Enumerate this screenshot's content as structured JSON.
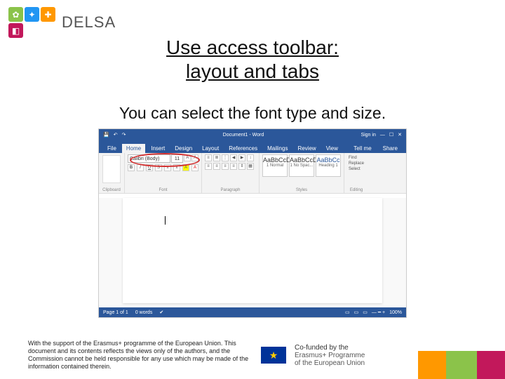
{
  "brand": "DELSA",
  "title_line1": "Use access toolbar:",
  "title_line2": "layout and tabs",
  "description": "You can select the font type and size.",
  "word": {
    "titlebar_center": "Document1 - Word",
    "titlebar_right": "Sign in",
    "tabs": [
      "File",
      "Home",
      "Insert",
      "Design",
      "Layout",
      "References",
      "Mailings",
      "Review",
      "View"
    ],
    "tell_me": "Tell me",
    "share": "Share",
    "groups": {
      "clipboard": "Clipboard",
      "font": "Font",
      "paragraph": "Paragraph",
      "styles": "Styles",
      "editing": "Editing"
    },
    "font_name": "Calibri (Body)",
    "font_size": "11",
    "buttons": {
      "b": "B",
      "i": "I",
      "u": "U",
      "s": "S"
    },
    "styles": [
      {
        "preview": "AaBbCcDd",
        "name": "1 Normal"
      },
      {
        "preview": "AaBbCcDd",
        "name": "1 No Spac..."
      },
      {
        "preview": "AaBbCc",
        "name": "Heading 1"
      }
    ],
    "editing_items": [
      "Find",
      "Replace",
      "Select"
    ],
    "status_page": "Page 1 of 1",
    "status_words": "0 words",
    "status_zoom": "100%"
  },
  "footer": {
    "disclaimer": "With the support of the Erasmus+ programme of the European Union. This document and its contents reflects the views only of the authors, and the Commission cannot be held responsible for any use which may be made of the information contained therein.",
    "eu_line1": "Co-funded by the",
    "eu_line2": "Erasmus+ Programme",
    "eu_line3": "of the European Union"
  }
}
